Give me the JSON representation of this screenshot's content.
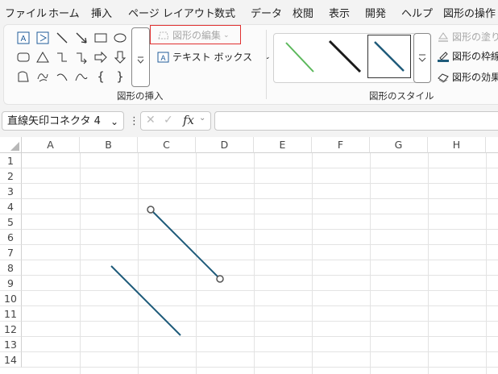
{
  "menu": {
    "items": [
      "ファイル",
      "ホーム",
      "挿入",
      "ページ レイアウト",
      "数式",
      "データ",
      "校閲",
      "表示",
      "開発",
      "ヘルプ",
      "図形の操作"
    ]
  },
  "ribbon": {
    "insert_group_label": "図形の挿入",
    "edit_shape_label": "図形の編集",
    "textbox_label": "テキスト ボックス",
    "style_group_label": "図形のスタイル",
    "fill_label": "図形の塗りつ",
    "outline_label": "図形の枠線",
    "effects_label": "図形の効果"
  },
  "formula_bar": {
    "name_box": "直線矢印コネクタ 4",
    "fx_label": "fx",
    "formula_value": ""
  },
  "sheet": {
    "columns": [
      "A",
      "B",
      "C",
      "D",
      "E",
      "F",
      "G",
      "H"
    ],
    "rows": [
      "1",
      "2",
      "3",
      "4",
      "5",
      "6",
      "7",
      "8",
      "9",
      "10",
      "11",
      "12",
      "13",
      "14"
    ]
  },
  "colors": {
    "accent_green": "#217346",
    "line_blue": "#1f5b7a",
    "highlight_red": "#e03030",
    "style_green": "#5cb85c"
  }
}
